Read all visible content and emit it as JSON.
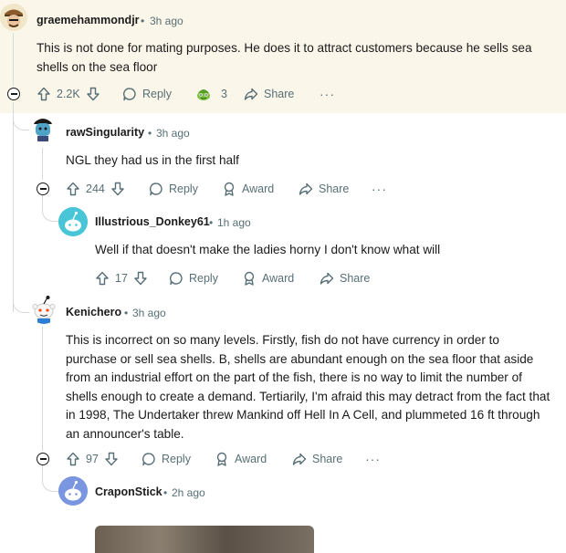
{
  "comments": [
    {
      "username": "graemehammondjr",
      "time": "3h ago",
      "body": "This is not done for mating purposes. He does it to attract customers because he sells sea shells on the sea floor",
      "votes": "2.2K",
      "award_count": "3",
      "reply": "Reply",
      "share": "Share",
      "more": "···"
    },
    {
      "username": "rawSingularity",
      "time": "3h ago",
      "body": "NGL they had us in the first half",
      "votes": "244",
      "reply": "Reply",
      "award": "Award",
      "share": "Share",
      "more": "···"
    },
    {
      "username": "Illustrious_Donkey61",
      "time": "1h ago",
      "body": "Well if that doesn't make the ladies horny I don't know what will",
      "votes": "17",
      "reply": "Reply",
      "award": "Award",
      "share": "Share"
    },
    {
      "username": "Kenichero",
      "time": "3h ago",
      "body": "This is incorrect on so many levels. Firstly, fish do not have currency in order to purchase or sell sea shells. B, shells are abundant enough on the sea floor that aside from an industrial effort on the part of the fish, there is no way to limit the number of shells enough to create a demand. Tertiarily, I'm afraid this may detract from the fact that in 1998, The Undertaker threw Mankind off Hell In A Cell, and plummeted 16 ft through an announcer's table.",
      "votes": "97",
      "reply": "Reply",
      "award": "Award",
      "share": "Share",
      "more": "···"
    },
    {
      "username": "CraponStick",
      "time": "2h ago"
    }
  ],
  "separator": "•",
  "colors": {
    "highlight": "#fbf6ea",
    "meta": "#576f76",
    "thread_line": "#d7dadc"
  }
}
